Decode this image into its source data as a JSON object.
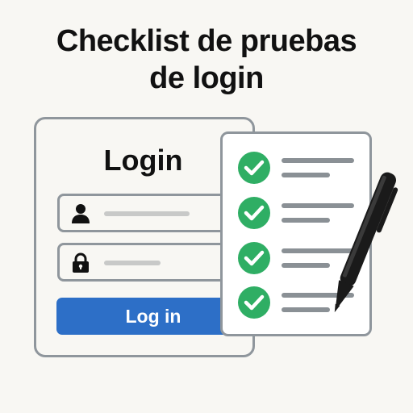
{
  "title": {
    "line1": "Checklist de pruebas",
    "line2": "de login"
  },
  "login_form": {
    "heading": "Login",
    "username_icon": "user-icon",
    "password_icon": "lock-icon",
    "button_label": "Log in"
  },
  "checklist": {
    "items": [
      {
        "checked": true,
        "icon": "check-circle-icon"
      },
      {
        "checked": true,
        "icon": "check-circle-icon"
      },
      {
        "checked": true,
        "icon": "check-circle-icon"
      },
      {
        "checked": true,
        "icon": "check-circle-icon"
      }
    ]
  },
  "pen_icon": "pen-icon",
  "colors": {
    "background": "#f8f7f3",
    "button": "#2d6fc7",
    "check_green": "#2fae64",
    "border": "#8f969c",
    "text": "#111111"
  }
}
